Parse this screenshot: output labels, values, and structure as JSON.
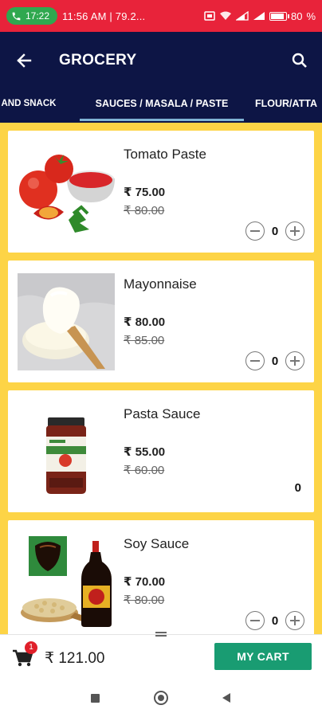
{
  "status_bar": {
    "call_time": "17:22",
    "text": "11:56 AM | 79.2...",
    "battery": "80",
    "battery_fraction": 0.8
  },
  "app_bar": {
    "title": "GROCERY",
    "back_icon": "arrow-left-icon",
    "search_icon": "search-icon"
  },
  "tabs": [
    {
      "label": "ST AND SNACK",
      "selected": false
    },
    {
      "label": "SAUCES / MASALA / PASTE",
      "selected": true
    },
    {
      "label": "FLOUR/ATTA",
      "selected": false
    }
  ],
  "products": [
    {
      "name": "Tomato Paste",
      "price": "₹ 75.00",
      "mrp": "₹ 80.00",
      "qty": "0",
      "image": "tomato-paste-image"
    },
    {
      "name": "Mayonnaise",
      "price": "₹ 80.00",
      "mrp": "₹ 85.00",
      "qty": "0",
      "image": "mayonnaise-image"
    },
    {
      "name": "Pasta Sauce",
      "price": "₹ 55.00",
      "mrp": "₹ 60.00",
      "qty": "0",
      "image": "pasta-sauce-image"
    },
    {
      "name": "Soy Sauce",
      "price": "₹ 70.00",
      "mrp": "₹ 80.00",
      "qty": "0",
      "image": "soy-sauce-image"
    }
  ],
  "cart": {
    "badge": "1",
    "total": "₹ 121.00",
    "button_label": "MY CART"
  },
  "colors": {
    "status_bar": "#e8233a",
    "app_bar": "#0d1545",
    "list_background": "#fdd446",
    "cart_button": "#199c72",
    "tab_indicator": "#7fb3d5"
  }
}
